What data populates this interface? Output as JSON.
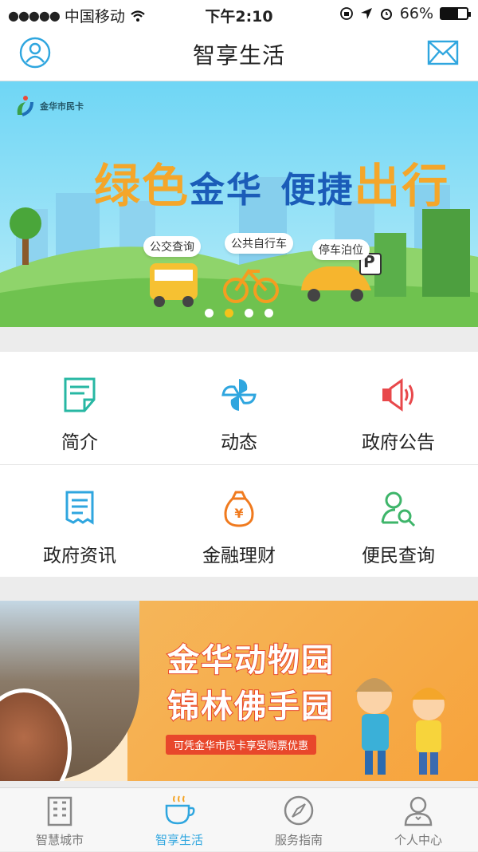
{
  "status_bar": {
    "signal": "●●●●●",
    "carrier": "中国移动",
    "time": "下午2:10",
    "battery": "66%",
    "battery_level": 0.66
  },
  "header": {
    "title": "智享生活"
  },
  "banner": {
    "logo_text": "金华市民卡",
    "headline_a": "绿色",
    "headline_b": "金华",
    "headline_c": "便捷",
    "headline_d": "出行",
    "tags": [
      "公交查询",
      "公共自行车",
      "停车泊位"
    ],
    "parking_sign": "P",
    "page_count": 4,
    "active_page": 2
  },
  "grid": {
    "items": [
      {
        "label": "简介",
        "icon": "document-icon",
        "color": "#27b7a3"
      },
      {
        "label": "动态",
        "icon": "pinwheel-icon",
        "color": "#2fa6df"
      },
      {
        "label": "政府公告",
        "icon": "megaphone-icon",
        "color": "#e8484b"
      },
      {
        "label": "政府资讯",
        "icon": "list-document-icon",
        "color": "#2fa6df"
      },
      {
        "label": "金融理财",
        "icon": "money-bag-icon",
        "color": "#f07a1e"
      },
      {
        "label": "便民查询",
        "icon": "user-search-icon",
        "color": "#3eb56a"
      }
    ]
  },
  "promo": {
    "line1": "金华动物园",
    "line2": "锦林佛手园",
    "subtitle": "可凭金华市民卡享受购票优惠"
  },
  "tabbar": {
    "items": [
      {
        "label": "智慧城市",
        "icon": "city-building-icon"
      },
      {
        "label": "智享生活",
        "icon": "coffee-cup-icon"
      },
      {
        "label": "服务指南",
        "icon": "compass-icon"
      },
      {
        "label": "个人中心",
        "icon": "person-icon"
      }
    ]
  },
  "colors": {
    "accent": "#2fa6df",
    "orange": "#f4a62a",
    "blue": "#1b5cb8"
  }
}
